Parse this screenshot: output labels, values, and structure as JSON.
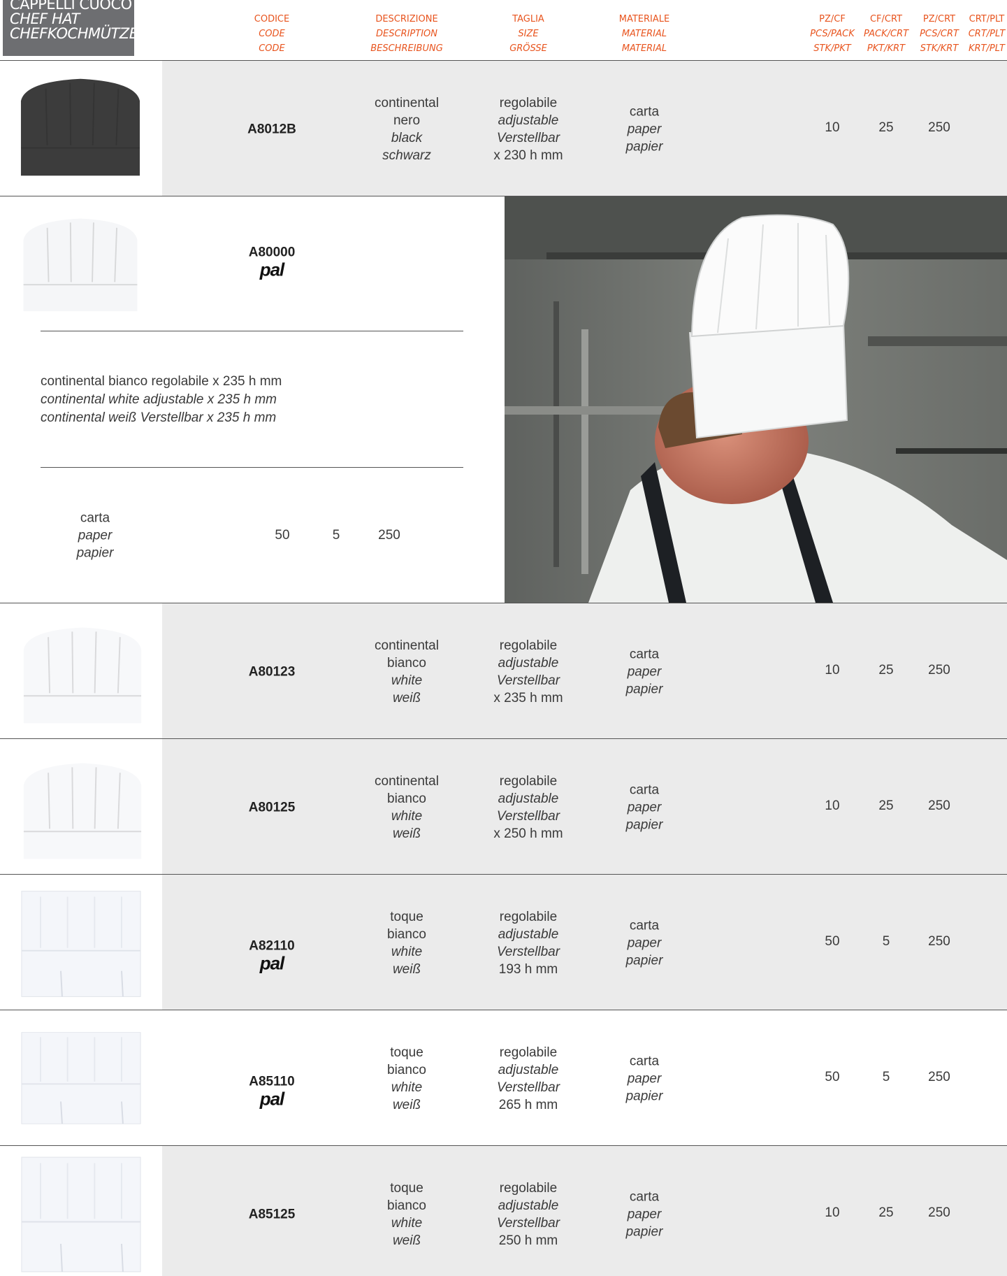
{
  "title": {
    "line1": "CAPPELLI CUOCO",
    "line2": "CHEF HAT",
    "line3": "CHEFKOCHMÜTZE"
  },
  "columns": {
    "code": [
      "CODICE",
      "CODE",
      "CODE"
    ],
    "description": [
      "DESCRIZIONE",
      "DESCRIPTION",
      "BESCHREIBUNG"
    ],
    "size": [
      "TAGLIA",
      "SIZE",
      "GRÖSSE"
    ],
    "material": [
      "MATERIALE",
      "MATERIAL",
      "MATERIAL"
    ],
    "pz_cf": [
      "PZ/CF",
      "PCS/PACK",
      "STK/PKT"
    ],
    "cf_crt": [
      "CF/CRT",
      "PACK/CRT",
      "PKT/KRT"
    ],
    "pz_crt": [
      "PZ/CRT",
      "PCS/CRT",
      "STK/KRT"
    ],
    "crt_plt": [
      "CRT/PLT",
      "CRT/PLT",
      "KRT/PLT"
    ]
  },
  "brand_pal": "pal",
  "rows": [
    {
      "code": "A8012B",
      "pal": "",
      "desc": [
        "continental",
        "nero",
        "black",
        "schwarz"
      ],
      "size": [
        "regolabile",
        "adjustable",
        "Verstellbar",
        "x 230 h mm"
      ],
      "material": [
        "carta",
        "paper",
        "papier"
      ],
      "pz_cf": "10",
      "cf_crt": "25",
      "pz_crt": "250",
      "hat_color": "#3c3c3c"
    },
    {
      "code": "A80123",
      "pal": "",
      "desc": [
        "continental",
        "bianco",
        "white",
        "weiß"
      ],
      "size": [
        "regolabile",
        "adjustable",
        "Verstellbar",
        "x 235 h mm"
      ],
      "material": [
        "carta",
        "paper",
        "papier"
      ],
      "pz_cf": "10",
      "cf_crt": "25",
      "pz_crt": "250"
    },
    {
      "code": "A80125",
      "pal": "",
      "desc": [
        "continental",
        "bianco",
        "white",
        "weiß"
      ],
      "size": [
        "regolabile",
        "adjustable",
        "Verstellbar",
        "x 250 h mm"
      ],
      "material": [
        "carta",
        "paper",
        "papier"
      ],
      "pz_cf": "10",
      "cf_crt": "25",
      "pz_crt": "250"
    },
    {
      "code": "A82110",
      "pal": "pal",
      "desc": [
        "toque",
        "bianco",
        "white",
        "weiß"
      ],
      "size": [
        "regolabile",
        "adjustable",
        "Verstellbar",
        "193 h mm"
      ],
      "material": [
        "carta",
        "paper",
        "papier"
      ],
      "pz_cf": "50",
      "cf_crt": "5",
      "pz_crt": "250"
    },
    {
      "code": "A85110",
      "pal": "pal",
      "desc": [
        "toque",
        "bianco",
        "white",
        "weiß"
      ],
      "size": [
        "regolabile",
        "adjustable",
        "Verstellbar",
        "265 h mm"
      ],
      "material": [
        "carta",
        "paper",
        "papier"
      ],
      "pz_cf": "50",
      "cf_crt": "5",
      "pz_crt": "250"
    },
    {
      "code": "A85125",
      "pal": "",
      "desc": [
        "toque",
        "bianco",
        "white",
        "weiß"
      ],
      "size": [
        "regolabile",
        "adjustable",
        "Verstellbar",
        "250 h mm"
      ],
      "material": [
        "carta",
        "paper",
        "papier"
      ],
      "pz_cf": "10",
      "cf_crt": "25",
      "pz_crt": "250"
    }
  ],
  "feature": {
    "code": "A80000",
    "pal": "pal",
    "desc_it": "continental bianco regolabile x 235 h mm",
    "desc_en": "continental white adjustable x 235 h mm",
    "desc_de": "continental weiß Verstellbar x 235 h mm",
    "material": [
      "carta",
      "paper",
      "papier"
    ],
    "pz_cf": "50",
    "cf_crt": "5",
    "pz_crt": "250"
  },
  "colors": {
    "accent": "#e8541e",
    "band": "#ebebeb",
    "title_bg": "#6d6e71"
  }
}
